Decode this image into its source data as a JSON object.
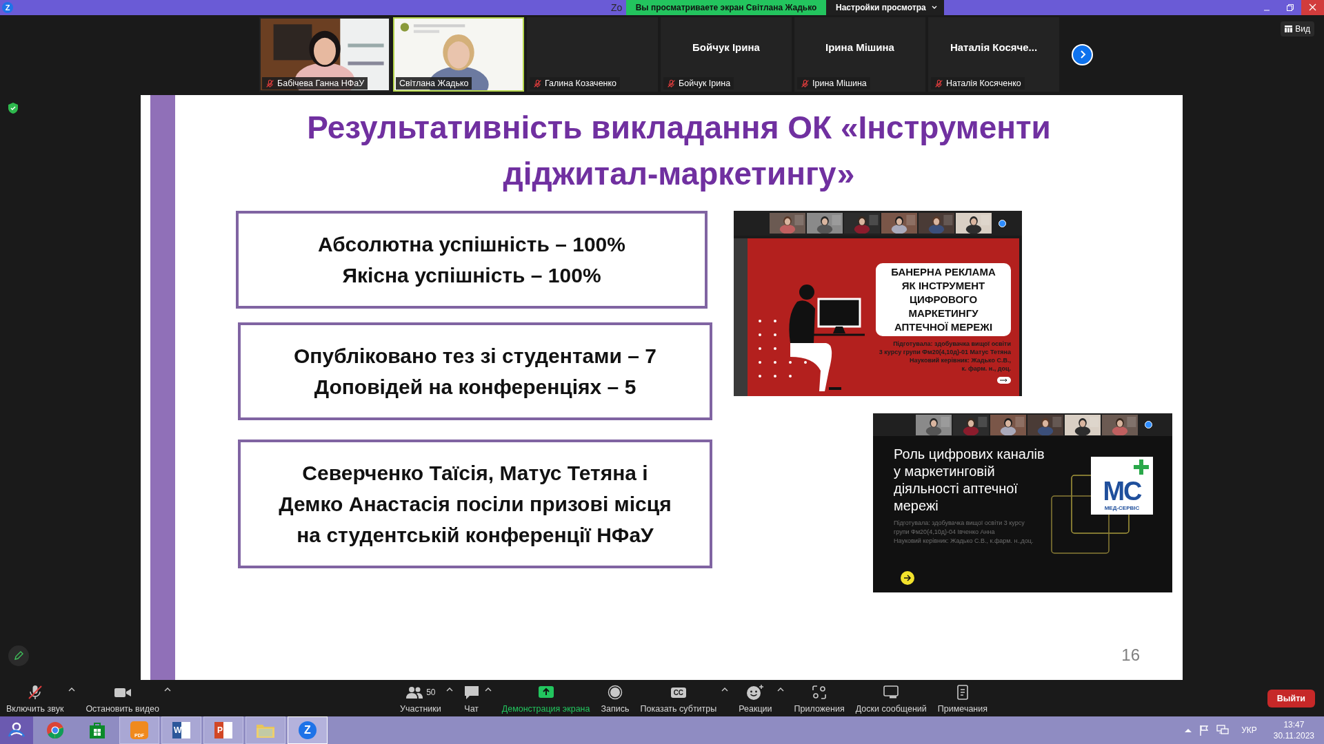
{
  "window": {
    "app_logo": "Z",
    "title": "Zo",
    "share_banner": "Вы просматриваете экран Світлана Жадько",
    "view_options": "Настройки просмотра"
  },
  "video_tiles": [
    {
      "kind": "video",
      "name": "Бабічева Ганна НФаУ",
      "muted": true,
      "speaking": false
    },
    {
      "kind": "video",
      "name": "Світлана Жадько",
      "muted": false,
      "speaking": true
    },
    {
      "kind": "blank",
      "name": "Галина Козаченко",
      "muted": true,
      "speaking": false
    },
    {
      "kind": "named",
      "display_name": "Бойчук Ірина",
      "name": "Бойчук Ірина",
      "muted": true,
      "speaking": false
    },
    {
      "kind": "named",
      "display_name": "Ірина Мішина",
      "name": "Ірина Мішина",
      "muted": true,
      "speaking": false
    },
    {
      "kind": "named",
      "display_name": "Наталія Косяче...",
      "name": "Наталія Косяченко",
      "muted": true,
      "speaking": false
    }
  ],
  "view_button": "Вид",
  "slide": {
    "title": "Результативність викладання ОК «Інструменти\nдіджитал-маркетингу»",
    "boxes": [
      {
        "text": "Абсолютна успішність – 100%\nЯкісна успішність – 100%"
      },
      {
        "text": "Опубліковано тез зі студентами – 7\nДоповідей на конференціях – 5"
      },
      {
        "text": "Северченко Таїсія, Матус Тетяна і\nДемко Анастасія посіли призові місця\nна студентській конференції НФаУ"
      }
    ],
    "screenshots": [
      {
        "kind": "red_slide",
        "heading": "БАНЕРНА РЕКЛАМА\nЯК ІНСТРУМЕНТ\nЦИФРОВОГО\nМАРКЕТИНГУ\nАПТЕЧНОЇ МЕРЕЖІ",
        "credits": "Підготувала: здобувачка вищої освіти\n3 курсу групи Фм20(4,10д)-01 Матус Тетяна\nНауковий керівник: Жадько С.В.,\nк. фарм. н., доц."
      },
      {
        "kind": "dark_slide",
        "heading": "Роль цифрових каналів\nу маркетинговій\nдіяльності аптечної\nмережі",
        "credits": "Підготувала: здобувачка вищої освіти 3 курсу\nгрупи Фм20(4,10д)-04 Івченко Анна\nНауковий керівник: Жадько С.В., к.фарм. н.,доц.",
        "logo_mark": "МС",
        "logo_text": "МЕД-СЕРВІС"
      }
    ],
    "page_number": "16"
  },
  "toolbar": {
    "items": [
      {
        "kind": "mic",
        "label": "Включить звук",
        "muted": true,
        "caret": true
      },
      {
        "kind": "video",
        "label": "Остановить видео",
        "caret": true
      },
      {
        "kind": "participants",
        "label": "Участники",
        "count": "50",
        "caret": true
      },
      {
        "kind": "chat",
        "label": "Чат",
        "caret": true
      },
      {
        "kind": "share",
        "label": "Демонстрация экрана",
        "caret": false
      },
      {
        "kind": "record",
        "label": "Запись",
        "caret": false
      },
      {
        "kind": "captions",
        "label": "Показать субтитры",
        "badge": "CC",
        "caret": true
      },
      {
        "kind": "reactions",
        "label": "Реакции",
        "caret": true
      },
      {
        "kind": "apps",
        "label": "Приложения",
        "caret": false
      },
      {
        "kind": "whiteboards",
        "label": "Доски сообщений",
        "caret": false
      },
      {
        "kind": "notes",
        "label": "Примечания",
        "caret": false
      }
    ],
    "leave_button": "Выйти"
  },
  "taskbar": {
    "apps": [
      {
        "kind": "start",
        "running": false,
        "active": false
      },
      {
        "kind": "browser",
        "running": false,
        "active": false
      },
      {
        "kind": "store",
        "running": false,
        "active": false
      },
      {
        "kind": "pdf",
        "glyph": "PDF",
        "running": true,
        "active": false
      },
      {
        "kind": "word",
        "glyph": "W",
        "running": true,
        "active": false
      },
      {
        "kind": "slides",
        "glyph": "P",
        "running": true,
        "active": false
      },
      {
        "kind": "folder",
        "running": true,
        "active": false
      },
      {
        "kind": "zoom",
        "glyph": "Z",
        "running": true,
        "active": true
      }
    ],
    "language": "УКР",
    "time": "13:47",
    "date": "30.11.2023"
  }
}
